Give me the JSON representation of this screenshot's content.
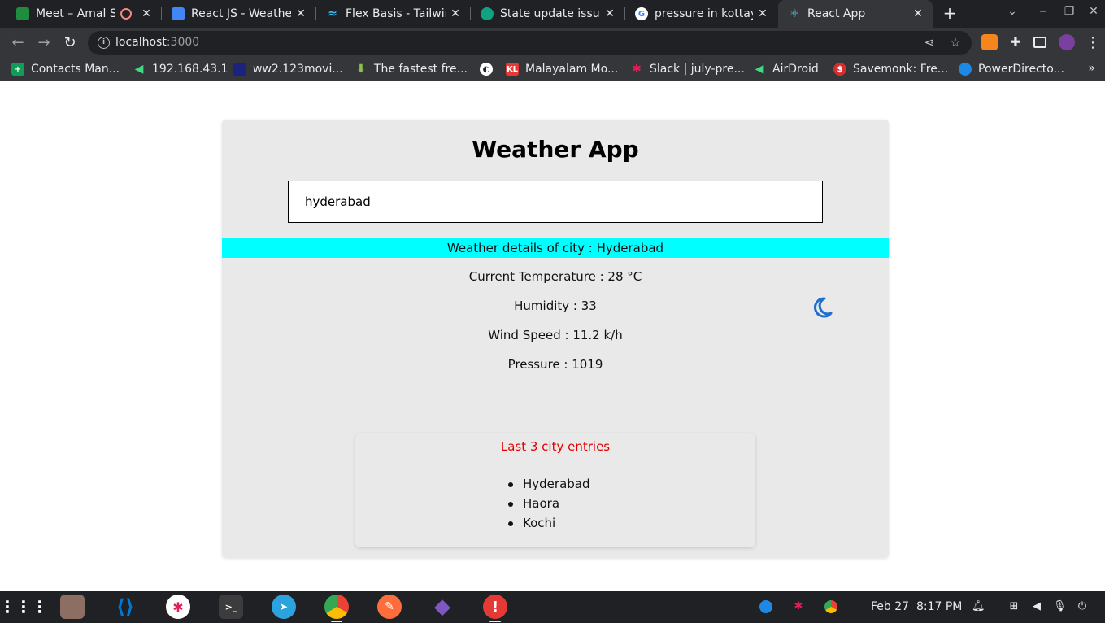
{
  "browser": {
    "tabs": [
      {
        "title": "Meet – Amal S |",
        "favicon_color": "#1e8e3e",
        "active": false
      },
      {
        "title": "React JS - Weather",
        "favicon_color": "#4285f4",
        "active": false
      },
      {
        "title": "Flex Basis - Tailwin",
        "favicon_color": "#38bdf8",
        "active": false
      },
      {
        "title": "State update issue",
        "favicon_color": "#10a37f",
        "active": false
      },
      {
        "title": "pressure in kottay",
        "favicon_color": "#4285f4",
        "active": false
      },
      {
        "title": "React App",
        "favicon_color": "#61dafb",
        "active": true
      }
    ],
    "url": {
      "host": "localhost",
      "port": ":3000"
    },
    "bookmarks": [
      {
        "label": "Contacts Man...",
        "color": "#0f9d58"
      },
      {
        "label": "192.168.43.1",
        "color": "#3ddc84"
      },
      {
        "label": "ww2.123movi...",
        "color": "#1a237e"
      },
      {
        "label": "The fastest fre...",
        "color": "#8bc34a"
      },
      {
        "label": "",
        "color": "#ffffff"
      },
      {
        "label": "Malayalam Mo...",
        "color": "#e53935"
      },
      {
        "label": "Slack | july-pre...",
        "color": "#e01e5a"
      },
      {
        "label": "AirDroid",
        "color": "#3ddc84"
      },
      {
        "label": "Savemonk: Fre...",
        "color": "#d32f2f"
      },
      {
        "label": "PowerDirecto...",
        "color": "#1e88e5"
      }
    ],
    "bookmarks_more": "»"
  },
  "app": {
    "title": "Weather App",
    "search": {
      "value": "hyderabad"
    },
    "details_banner": "Weather details of city : Hyderabad",
    "stats": {
      "temperature": "Current Temperature : 28 °C",
      "humidity": "Humidity : 33",
      "wind": "Wind Speed : 11.2 k/h",
      "pressure": "Pressure : 1019"
    },
    "weather_icon": "moon-icon",
    "history": {
      "title": "Last 3 city entries",
      "items": [
        "Hyderabad",
        "Haora",
        "Kochi"
      ]
    }
  },
  "taskbar": {
    "date": "Feb 27",
    "time": "8:17 PM"
  },
  "colors": {
    "banner": "#00ffff",
    "history_title": "#e00000",
    "moon": "#1e6fd0"
  }
}
